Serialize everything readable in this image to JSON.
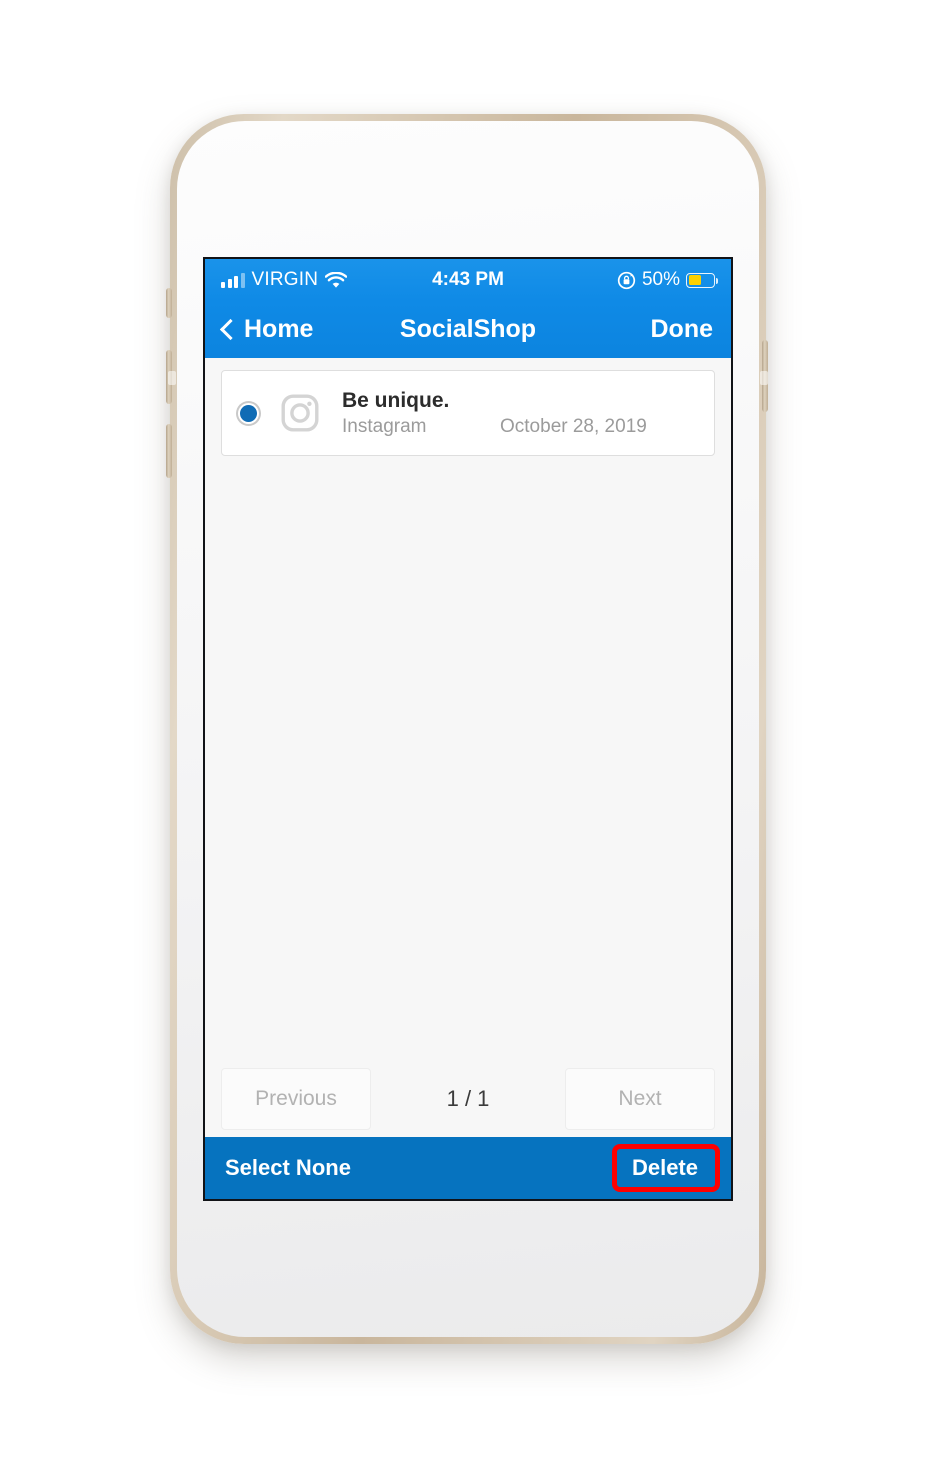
{
  "device": {
    "kind": "iphone-gold-white",
    "bezel_color": "#d5c6b0",
    "home_button_ring_color": "#c8a88a"
  },
  "status_bar": {
    "carrier": "VIRGIN",
    "signal_icon": "signal-bars-icon",
    "signal_bars_filled": 3,
    "signal_bars_total": 4,
    "wifi_icon": "wifi-icon",
    "time": "4:43 PM",
    "rotation_lock_icon": "rotation-lock-icon",
    "battery_percent": "50%",
    "battery_level": 50,
    "battery_color": "#fdd100",
    "background_color": "#0f8ae6"
  },
  "nav_bar": {
    "back_icon": "chevron-left-icon",
    "back_label": "Home",
    "title": "SocialShop",
    "done_label": "Done",
    "background_color": "#0f8ae6"
  },
  "list": {
    "items": [
      {
        "selected": true,
        "radio_icon": "radio-selected-icon",
        "network_icon": "instagram-icon",
        "title": "Be unique.",
        "network": "Instagram",
        "date": "October 28, 2019"
      }
    ]
  },
  "pagination": {
    "previous_label": "Previous",
    "previous_enabled": false,
    "page_indicator": "1 / 1",
    "next_label": "Next",
    "next_enabled": false
  },
  "toolbar": {
    "select_none_label": "Select None",
    "delete_label": "Delete",
    "delete_highlighted": true,
    "highlight_color": "#fe0000",
    "background_color": "#0673bf"
  }
}
